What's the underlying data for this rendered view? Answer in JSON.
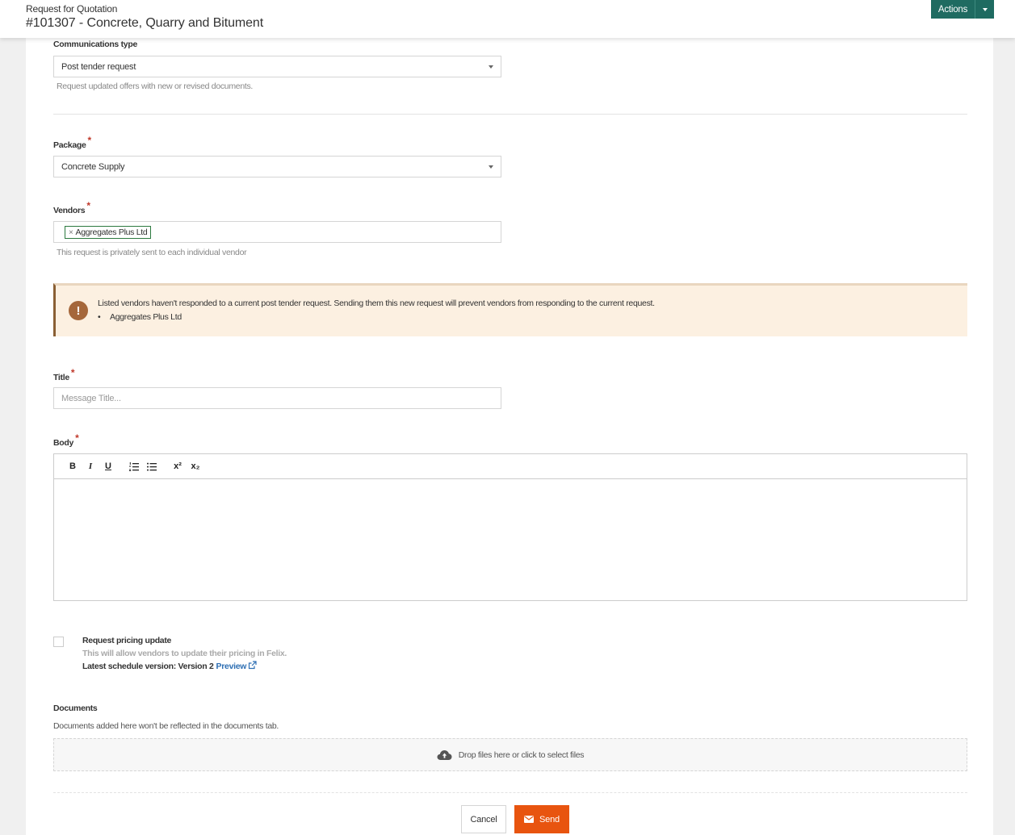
{
  "header": {
    "breadcrumb": "Request for Quotation",
    "title": "#101307 - Concrete, Quarry and Bitument",
    "actions_label": "Actions"
  },
  "form": {
    "communications_type": {
      "label": "Communications type",
      "value": "Post tender request",
      "help": "Request updated offers with new or revised documents."
    },
    "package": {
      "label": "Package",
      "required_mark": "*",
      "value": "Concrete Supply"
    },
    "vendors": {
      "label": "Vendors",
      "required_mark": "*",
      "tags": [
        {
          "remove": "×",
          "label": "Aggregates Plus Ltd"
        }
      ],
      "help": "This request is privately sent to each individual vendor"
    },
    "warning": {
      "icon": "exclamation-icon",
      "message": "Listed vendors haven't responded to a current post tender request. Sending them this new request will prevent vendors from responding to the current request.",
      "bullet": "•",
      "vendors": [
        "Aggregates Plus Ltd"
      ]
    },
    "title_field": {
      "label": "Title",
      "required_mark": "*",
      "placeholder": "Message Title..."
    },
    "body_field": {
      "label": "Body",
      "required_mark": "*",
      "toolbar": {
        "bold": "B",
        "italic": "I",
        "underline": "U",
        "superscript": "x²",
        "subscript": "x₂"
      }
    },
    "pricing_update": {
      "label": "Request pricing update",
      "help": "This will allow vendors to update their pricing in Felix.",
      "version_text": "Latest schedule version: Version 2",
      "preview_label": "Preview",
      "checked": false
    },
    "documents": {
      "label": "Documents",
      "help": "Documents added here won't be reflected in the documents tab.",
      "dropzone_text": "Drop files here or click to select files"
    }
  },
  "footer": {
    "cancel_label": "Cancel",
    "send_label": "Send"
  },
  "colors": {
    "brand_teal": "#1f6b61",
    "send_orange": "#e8540f",
    "warning_bg": "#fcf0e1",
    "warning_icon": "#a5673b",
    "link_blue": "#2e6fb3",
    "required_red": "#c0392b"
  }
}
